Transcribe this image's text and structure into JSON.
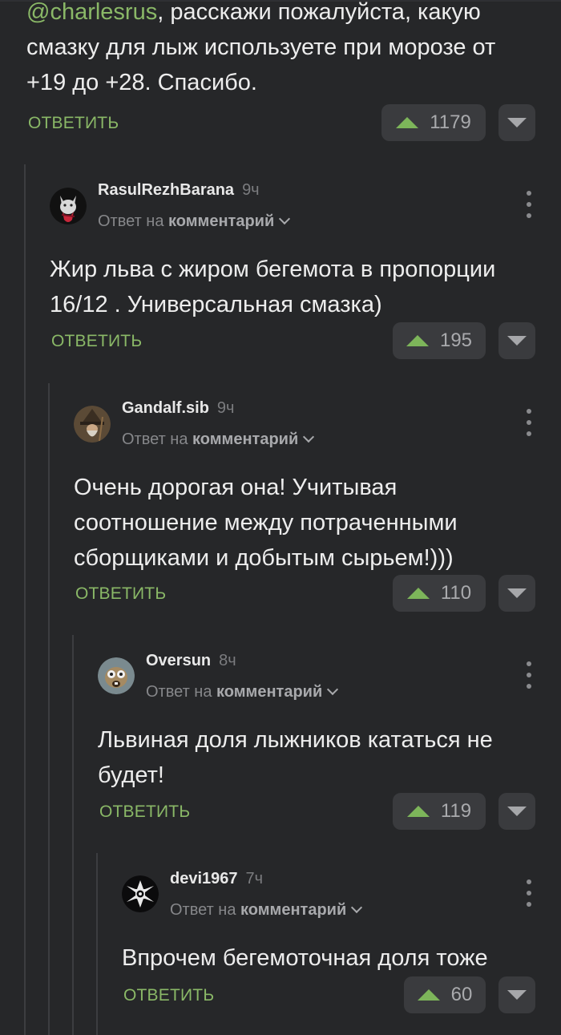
{
  "colors": {
    "background": "#262729",
    "accent": "#8ab867",
    "upvote": "#7db55a",
    "button_bg": "#3a3b3e"
  },
  "comment0": {
    "mention": "@charlesrus",
    "text": ", расскажи пожалуйста, какую\nсмазку для лыж используете при морозе от\n+19 до +28. Спасибо.",
    "reply_label": "ОТВЕТИТЬ",
    "votes": "1179"
  },
  "comments": [
    {
      "username": "RasulRezhBarana",
      "time": "9ч",
      "reply_prefix": "Ответ на",
      "reply_target": "комментарий",
      "text": "Жир льва с жиром бегемота в пропорции\n16/12 . Универсальная смазка)",
      "reply_label": "ОТВЕТИТЬ",
      "votes": "195",
      "avatar_icon": "red-fox-avatar"
    },
    {
      "username": "Gandalf.sib",
      "time": "9ч",
      "reply_prefix": "Ответ на",
      "reply_target": "комментарий",
      "text": "Очень дорогая она! Учитывая\nсоотношение между потраченными\nсборщиками и добытым сырьем!)))",
      "reply_label": "ОТВЕТИТЬ",
      "votes": "110",
      "avatar_icon": "wizard-avatar"
    },
    {
      "username": "Oversun",
      "time": "8ч",
      "reply_prefix": "Ответ на",
      "reply_target": "комментарий",
      "text": "Львиная доля лыжников кататься не\nбудет!",
      "reply_label": "ОТВЕТИТЬ",
      "votes": "119",
      "avatar_icon": "squirrel-avatar"
    },
    {
      "username": "devi1967",
      "time": "7ч",
      "reply_prefix": "Ответ на",
      "reply_target": "комментарий",
      "text": "Впрочем бегемоточная доля тоже",
      "reply_label": "ОТВЕТИТЬ",
      "votes": "60",
      "avatar_icon": "iron-cross-avatar"
    }
  ]
}
